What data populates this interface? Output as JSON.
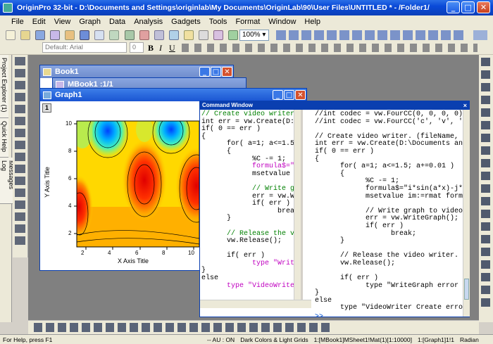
{
  "window": {
    "title": "OriginPro 32-bit - D:\\Documents and Settings\\originlab\\My Documents\\OriginLab\\90\\User Files\\UNTITLED * - /Folder1/"
  },
  "menu": [
    "File",
    "Edit",
    "View",
    "Graph",
    "Data",
    "Analysis",
    "Gadgets",
    "Tools",
    "Format",
    "Window",
    "Help"
  ],
  "toolbar": {
    "zoom": "100%",
    "font": "Default: Arial",
    "font_size": "0"
  },
  "side_tabs": [
    "Project Explorer (1)",
    "Quick Help",
    "Messages Log"
  ],
  "book1": {
    "title": "Book1"
  },
  "mbook1": {
    "title": "MBook1 :1/1"
  },
  "graph1": {
    "title": "Graph1",
    "layer": "1",
    "chart_data": {
      "type": "heatmap",
      "xlabel": "X Axis Title",
      "ylabel": "Y Axis Title",
      "xlim": [
        1,
        10
      ],
      "ylim": [
        1,
        10
      ],
      "xticks": [
        "2",
        "4",
        "6",
        "8",
        "10"
      ],
      "yticks": [
        "2",
        "4",
        "6",
        "8",
        "10"
      ]
    }
  },
  "command_window": {
    "title": "Command Window",
    "left_code": [
      {
        "t": "// Create video writer. (",
        "c": "cm"
      },
      {
        "t": "int err = vw.Create(D:\\Doc"
      },
      {
        "t": "if( 0 == err )"
      },
      {
        "t": "{"
      },
      {
        "t": "      for( a=1; a<=1.5; a+"
      },
      {
        "t": "      {"
      },
      {
        "t": "            %C -= 1;"
      },
      {
        "t": "            formula$=\"i*s",
        "s": true
      },
      {
        "t": "            msetvalue im:="
      },
      {
        "t": ""
      },
      {
        "t": "            // Write graph",
        "c": "cm"
      },
      {
        "t": "            err = vw.Write"
      },
      {
        "t": "            if( err )"
      },
      {
        "t": "                  break;"
      },
      {
        "t": "      }"
      },
      {
        "t": ""
      },
      {
        "t": "      // Release the video",
        "c": "cm"
      },
      {
        "t": "      vw.Release();"
      },
      {
        "t": ""
      },
      {
        "t": "      if( err )"
      },
      {
        "t": "            type \"WriteGra",
        "s": true
      },
      {
        "t": "}"
      },
      {
        "t": "else"
      },
      {
        "t": "      type \"VideoWriter C",
        "s": true
      }
    ],
    "right_code": [
      "//int codec = vw.FourCC(0, 0, 0, 0);",
      "//int codec = vw.FourCC('c', 'v', 'i',",
      "",
      "// Create video writer. (fileName, co",
      "int err = vw.Create(D:\\Documents and",
      "if( 0 == err )",
      "{",
      "      for( a=1; a<=1.5; a+=0.01 )",
      "      {",
      "            %C -= 1;",
      "            formula$=\"i*sin(a*x)-j*co",
      "            msetvalue im:=rmat formu",
      "",
      "            // Write graph to video a",
      "            err = vw.WriteGraph();",
      "            if( err )",
      "                  break;",
      "      }",
      "",
      "      // Release the video writer.",
      "      vw.Release();",
      "",
      "      if( err )",
      "            type \"WriteGraph error $(",
      "}",
      "else",
      "      type \"VideoWriter Create error"
    ],
    "prompt": ">>"
  },
  "status": {
    "help": "For Help, press F1",
    "items": [
      "-- AU : ON",
      "Dark Colors & Light Grids",
      "1:[MBook1]MSheet1!Mat(1)[1:10000]",
      "1:[Graph1]1!1",
      "Radian"
    ]
  }
}
